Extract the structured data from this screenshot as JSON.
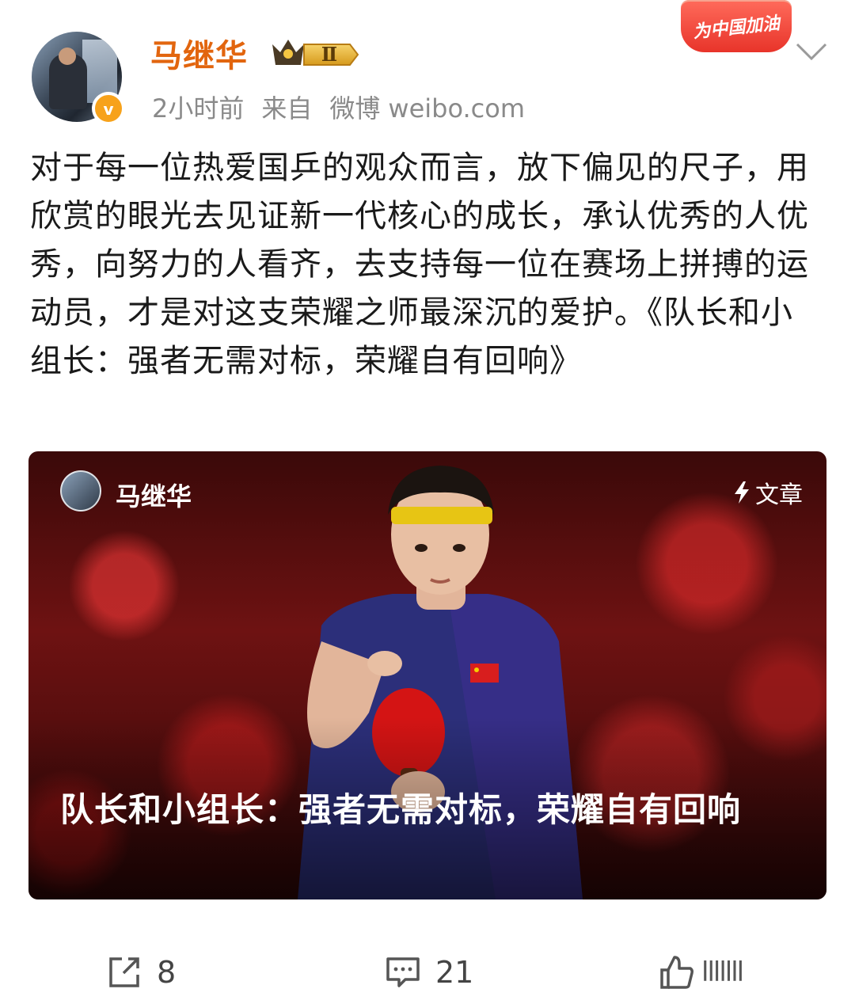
{
  "post": {
    "author": {
      "name": "马继华",
      "level_label": "Ⅱ",
      "verified_mark": "v"
    },
    "meta": {
      "time": "2小时前",
      "source_prefix": "来自",
      "source_name": "微博",
      "source_domain": "weibo.com"
    },
    "campaign_badge": "为中国加油",
    "body": "对于每一位热爱国乒的观众而言，放下偏见的尺子，用欣赏的眼光去见证新一代核心的成长，承认优秀的人优秀，向努力的人看齐，去支持每一位在赛场上拼搏的运动员，才是对这支荣耀之师最深沉的爱护。《队长和小组长：强者无需对标，荣耀自有回响》",
    "card": {
      "author_name": "马继华",
      "type_label": "文章",
      "title": "队长和小组长：强者无需对标，荣耀自有回响"
    },
    "actions": {
      "share_count": "8",
      "comment_count": "21",
      "like_count": "lllllll"
    }
  },
  "colors": {
    "username": "#e2650e",
    "meta_text": "#8a8a8a",
    "verified": "#f7a21b",
    "campaign_red": "#e8342a"
  },
  "icons": [
    "level-crown-icon",
    "chevron-down-icon",
    "lightning-icon",
    "share-icon",
    "comment-icon",
    "like-icon"
  ]
}
